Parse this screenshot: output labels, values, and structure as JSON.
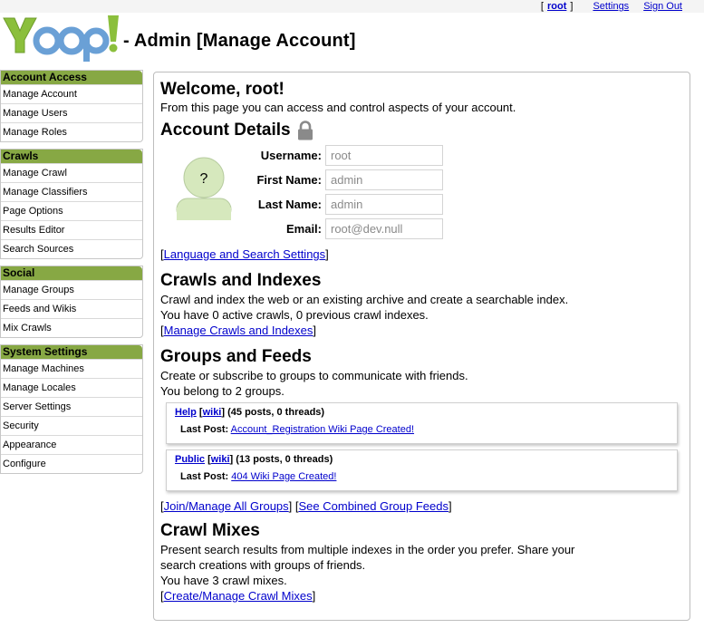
{
  "top_links": {
    "user": "root",
    "settings": "Settings",
    "sign_out": "Sign Out"
  },
  "header": {
    "logo_text": "Yioop!",
    "page_title": "- Admin [Manage Account]"
  },
  "colors": {
    "menu_header": "#87a844",
    "link": "#0000cc",
    "logo_blue": "#6aa0d6",
    "logo_green": "#8bbf3c"
  },
  "sidebar": {
    "groups": [
      {
        "title": "Account Access",
        "items": [
          "Manage Account",
          "Manage Users",
          "Manage Roles"
        ]
      },
      {
        "title": "Crawls",
        "items": [
          "Manage Crawl",
          "Manage Classifiers",
          "Page Options",
          "Results Editor",
          "Search Sources"
        ]
      },
      {
        "title": "Social",
        "items": [
          "Manage Groups",
          "Feeds and Wikis",
          "Mix Crawls"
        ]
      },
      {
        "title": "System Settings",
        "items": [
          "Manage Machines",
          "Manage Locales",
          "Server Settings",
          "Security",
          "Appearance",
          "Configure"
        ]
      }
    ]
  },
  "main": {
    "welcome": "Welcome, root!",
    "intro": "From this page you can access and control aspects of your account.",
    "account_details": {
      "title": "Account Details",
      "lock_icon": "lock-icon",
      "avatar_placeholder": "?",
      "fields": [
        {
          "label": "Username:",
          "value": "root"
        },
        {
          "label": "First Name:",
          "value": "admin"
        },
        {
          "label": "Last Name:",
          "value": "admin"
        },
        {
          "label": "Email:",
          "value": "root@dev.null"
        }
      ],
      "settings_link": "Language and Search Settings"
    },
    "crawls": {
      "title": "Crawls and Indexes",
      "desc": "Crawl and index the web or an existing archive and create a searchable index.",
      "status": "You have 0 active crawls, 0 previous crawl indexes.",
      "link": "Manage Crawls and Indexes"
    },
    "groups": {
      "title": "Groups and Feeds",
      "desc": "Create or subscribe to groups to communicate with friends.",
      "status": "You belong to 2 groups.",
      "items": [
        {
          "name": "Help",
          "wiki": "wiki",
          "counts": "(45 posts, 0 threads)",
          "last_post_label": "Last Post:",
          "last_post": "Account_Registration Wiki Page Created!"
        },
        {
          "name": "Public",
          "wiki": "wiki",
          "counts": "(13 posts, 0 threads)",
          "last_post_label": "Last Post:",
          "last_post": "404 Wiki Page Created!"
        }
      ],
      "link_join": "Join/Manage All Groups",
      "link_feeds": "See Combined Group Feeds"
    },
    "mixes": {
      "title": "Crawl Mixes",
      "desc_line1": "Present search results from multiple indexes in the order you prefer. Share your",
      "desc_line2": "search creations with groups of friends.",
      "status": "You have 3 crawl mixes.",
      "link": "Create/Manage Crawl Mixes"
    }
  }
}
